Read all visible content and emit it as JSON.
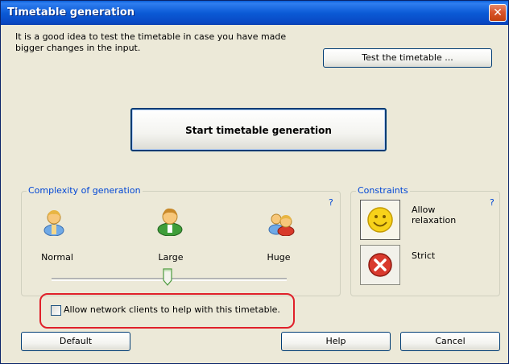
{
  "window": {
    "title": "Timetable generation",
    "close_glyph": "✕"
  },
  "info_text": "It is a good idea to test the timetable in case you have made bigger changes in the input.",
  "buttons": {
    "test": "Test the timetable ...",
    "start": "Start timetable generation",
    "default": "Default",
    "help": "Help",
    "cancel": "Cancel"
  },
  "complexity": {
    "legend": "Complexity of generation",
    "help_mark": "?",
    "levels": [
      "Normal",
      "Large",
      "Huge"
    ],
    "selected_level": "Large"
  },
  "constraints": {
    "legend": "Constraints",
    "help_mark": "?",
    "options": [
      "Allow relaxation",
      "Strict"
    ],
    "selected": "Allow relaxation"
  },
  "network_checkbox": {
    "label": "Allow network clients to help with this timetable.",
    "checked": false
  },
  "colors": {
    "titlebar": "#0b5bd6",
    "legend_text": "#0046d5",
    "highlight_outline": "#e0202a"
  }
}
